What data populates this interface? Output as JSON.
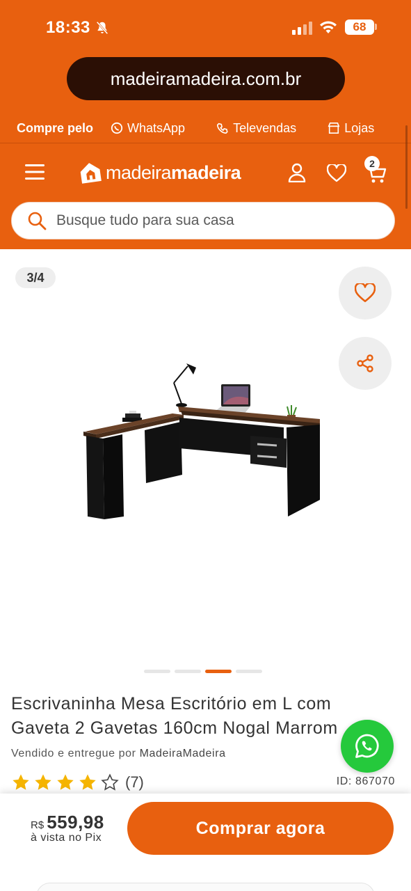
{
  "status_bar": {
    "time": "18:33",
    "battery": "68"
  },
  "browser": {
    "url": "madeiramadeira.com.br"
  },
  "contact_strip": {
    "lead": "Compre pelo",
    "items": [
      "WhatsApp",
      "Televendas",
      "Lojas"
    ]
  },
  "header": {
    "logo_regular": "madeira",
    "logo_bold": "madeira",
    "cart_count": "2"
  },
  "search": {
    "placeholder": "Busque tudo para sua casa"
  },
  "gallery": {
    "counter": "3/4",
    "current_index": 3,
    "total": 4
  },
  "product": {
    "title": "Escrivaninha Mesa Escritório em L com Gaveta 2 Gavetas 160cm Nogal Marrom",
    "seller_prefix": "Vendido e entregue por",
    "seller_name": "MadeiraMadeira",
    "rating": 4,
    "rating_max": 5,
    "review_count": "(7)",
    "id_label": "ID: 867070"
  },
  "buy_bar": {
    "currency": "R$",
    "price": "559,98",
    "price_note": "à vista no Pix",
    "buy_label": "Comprar agora"
  },
  "colors": {
    "brand_orange": "#E8600F",
    "whatsapp_green": "#25C93C",
    "star_yellow": "#F5B400"
  }
}
